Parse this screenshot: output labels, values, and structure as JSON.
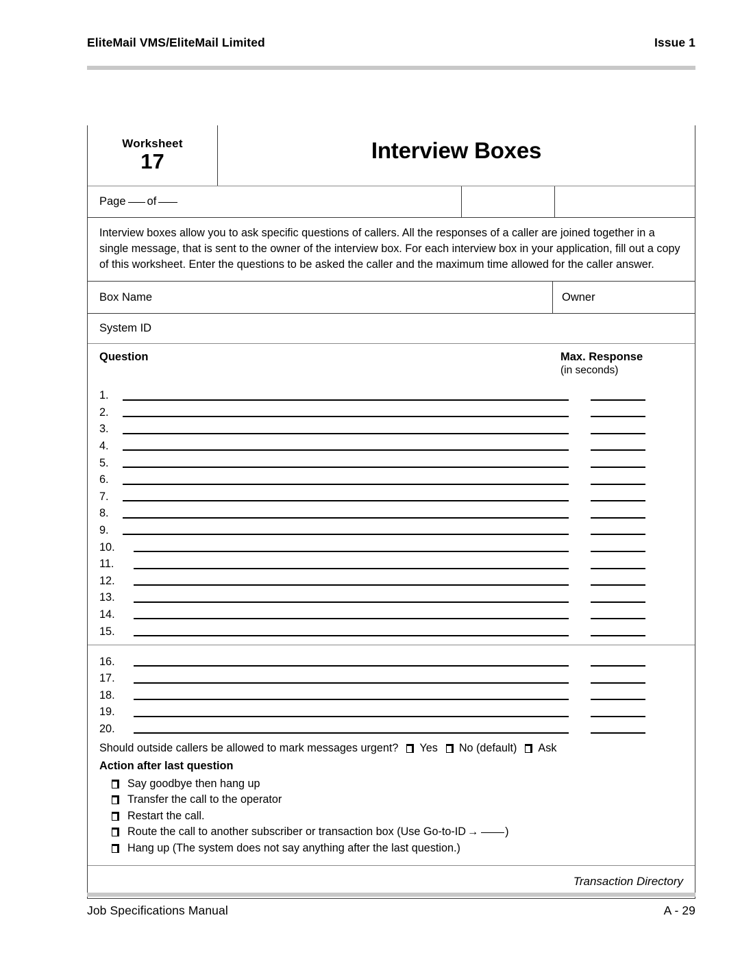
{
  "header": {
    "left_title": "EliteMail VMS/EliteMail Limited",
    "right_title": "Issue 1"
  },
  "footer": {
    "manual_name": "Job Specifications Manual",
    "page_number": "A - 29"
  },
  "worksheet": {
    "label": "Worksheet",
    "number": "17",
    "title": "Interview Boxes",
    "page_of_prefix": "Page",
    "page_of_middle": "of",
    "intro": "Interview boxes allow you to ask specific questions of callers. All the responses of a caller are joined together in a single message, that is sent to the owner of the interview box. For each interview box in your application, fill out a copy of this worksheet. Enter the questions to be asked the caller and the maximum time allowed for the caller answer.",
    "box_name_label": "Box Name",
    "owner_label": "Owner",
    "system_id_label": "System ID",
    "question_column_header": "Question",
    "max_response_header": "Max. Response",
    "max_response_subheader": "(in seconds)",
    "question_numbers_first": [
      "1.",
      "2.",
      "3.",
      "4.",
      "5.",
      "6.",
      "7.",
      "8.",
      "9.",
      "10.",
      "11.",
      "12.",
      "13.",
      "14.",
      "15."
    ],
    "question_numbers_second": [
      "16.",
      "17.",
      "18.",
      "19.",
      "20."
    ],
    "urgent_question": "Should outside callers be allowed to mark messages urgent?",
    "urgent_options": [
      "Yes",
      "No (default)",
      "Ask"
    ],
    "action_title": "Action after last question",
    "action_options": [
      "Say goodbye then hang up",
      "Transfer the call to the operator",
      "Restart the call.",
      "Route the call to another subscriber or transaction box (Use Go-to-ID",
      "Hang up (The system does not say anything after the last question.)"
    ],
    "goto_arrow": "→",
    "goto_close_paren": ")",
    "footer_note": "Transaction Directory"
  }
}
